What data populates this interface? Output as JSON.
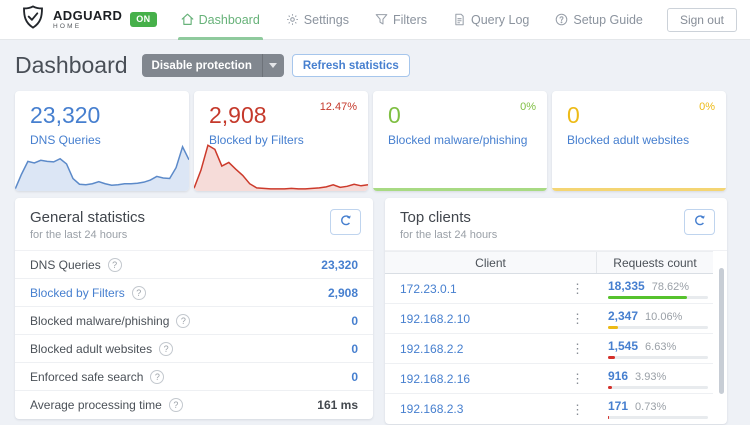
{
  "icons": {
    "question": "?",
    "kebab": "⋮"
  },
  "header": {
    "logo_title": "ADGUARD",
    "logo_sub": "HOME",
    "badge": "ON",
    "nav": [
      {
        "label": "Dashboard"
      },
      {
        "label": "Settings"
      },
      {
        "label": "Filters"
      },
      {
        "label": "Query Log"
      },
      {
        "label": "Setup Guide"
      }
    ],
    "sign_out_label": "Sign out"
  },
  "page": {
    "title": "Dashboard",
    "disable_protection_label": "Disable protection",
    "refresh_statistics_label": "Refresh statistics"
  },
  "stat_cards": [
    {
      "value": "23,320",
      "label": "DNS Queries",
      "percent": "",
      "value_color": "#467fcf",
      "line_color": "#5c8ac9",
      "fill_color": "#dce6f5",
      "sparkline": [
        3,
        32,
        57,
        54,
        59,
        57,
        56,
        62,
        52,
        24,
        13,
        12,
        14,
        18,
        14,
        11,
        12,
        14,
        14,
        15,
        17,
        21,
        28,
        25,
        24,
        45,
        85,
        60
      ]
    },
    {
      "value": "2,908",
      "label": "Blocked by Filters",
      "percent": "12.47%",
      "value_color": "#c5392b",
      "line_color": "#cc3a2b",
      "fill_color": "#f6dcd9",
      "sparkline": [
        5,
        40,
        88,
        80,
        48,
        55,
        42,
        30,
        14,
        6,
        5,
        4,
        4,
        4,
        5,
        4,
        4,
        5,
        6,
        8,
        12,
        7,
        9,
        13,
        10,
        12
      ]
    },
    {
      "value": "0",
      "label": "Blocked malware/phishing",
      "percent": "0%",
      "value_color": "#7fbf43",
      "line_color": "#a8da83",
      "fill_color": "#a8da83",
      "flat": true
    },
    {
      "value": "0",
      "label": "Blocked adult websites",
      "percent": "0%",
      "value_color": "#edbb18",
      "line_color": "#f4d573",
      "fill_color": "#f4d573",
      "flat": true
    }
  ],
  "general_statistics": {
    "title": "General statistics",
    "subtitle": "for the last 24 hours",
    "rows": [
      {
        "label": "DNS Queries",
        "value": "23,320",
        "link": false,
        "dark": false
      },
      {
        "label": "Blocked by Filters",
        "value": "2,908",
        "link": true,
        "dark": false
      },
      {
        "label": "Blocked malware/phishing",
        "value": "0",
        "link": false,
        "dark": false
      },
      {
        "label": "Blocked adult websites",
        "value": "0",
        "link": false,
        "dark": false
      },
      {
        "label": "Enforced safe search",
        "value": "0",
        "link": false,
        "dark": false
      },
      {
        "label": "Average processing time",
        "value": "161 ms",
        "link": false,
        "dark": true
      }
    ]
  },
  "top_clients": {
    "title": "Top clients",
    "subtitle": "for the last 24 hours",
    "columns": [
      "Client",
      "Requests count"
    ],
    "rows": [
      {
        "client": "172.23.0.1",
        "count": "18,335",
        "percent": "78.62%",
        "pct": 78.62,
        "bar_color": "#56c22d"
      },
      {
        "client": "192.168.2.10",
        "count": "2,347",
        "percent": "10.06%",
        "pct": 10.06,
        "bar_color": "#ecba16"
      },
      {
        "client": "192.168.2.2",
        "count": "1,545",
        "percent": "6.63%",
        "pct": 6.63,
        "bar_color": "#d4302a"
      },
      {
        "client": "192.168.2.16",
        "count": "916",
        "percent": "3.93%",
        "pct": 3.93,
        "bar_color": "#d4302a"
      },
      {
        "client": "192.168.2.3",
        "count": "171",
        "percent": "0.73%",
        "pct": 0.73,
        "bar_color": "#d4302a"
      }
    ]
  }
}
